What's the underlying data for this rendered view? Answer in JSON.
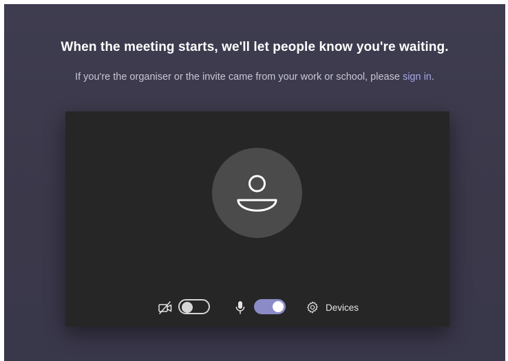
{
  "lobby": {
    "heading": "When the meeting starts, we'll let people know you're waiting.",
    "subtext": "If you're the organiser or the invite came from your work or school, please",
    "sign_in_link": "sign in",
    "sign_in_suffix": "."
  },
  "controls": {
    "camera": {
      "icon": "camera-off-icon",
      "enabled": false
    },
    "microphone": {
      "icon": "microphone-icon",
      "enabled": true
    },
    "devices_label": "Devices",
    "devices_icon": "gear-icon"
  },
  "colors": {
    "background": "#3c3a4c",
    "preview_background": "#262626",
    "avatar_background": "#4b4b4b",
    "accent": "#8b8cc7",
    "link": "#a6a7e6"
  }
}
